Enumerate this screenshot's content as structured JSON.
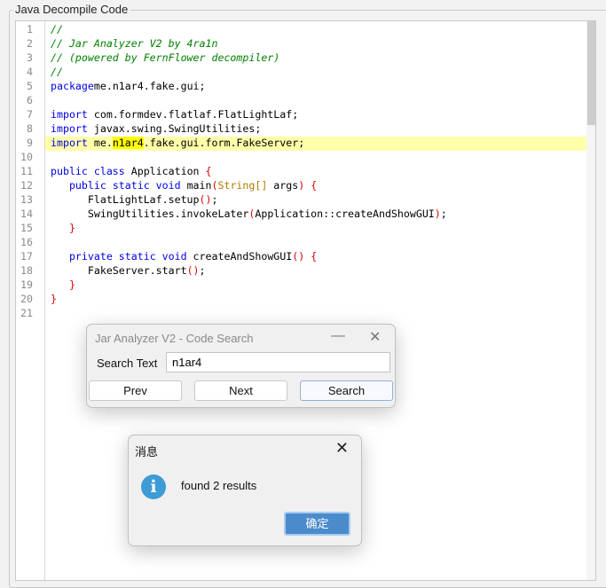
{
  "panel": {
    "title": "Java Decompile Code"
  },
  "editor": {
    "highlight_line": 9,
    "lines": [
      [
        [
          "cm",
          "//"
        ]
      ],
      [
        [
          "cm",
          "// Jar Analyzer V2 by 4ra1n"
        ]
      ],
      [
        [
          "cm",
          "// (powered by FernFlower decompiler)"
        ]
      ],
      [
        [
          "cm",
          "//"
        ]
      ],
      [
        [
          "kw",
          "package"
        ],
        [
          "",
          "me.n1ar4.fake.gui;"
        ]
      ],
      [],
      [
        [
          "kw",
          "import"
        ],
        [
          "",
          " com.formdev.flatlaf.FlatLightLaf;"
        ]
      ],
      [
        [
          "kw",
          "import"
        ],
        [
          "",
          " javax.swing.SwingUtilities;"
        ]
      ],
      [
        [
          "kw",
          "import"
        ],
        [
          "",
          " me."
        ],
        [
          "mk",
          "n1ar4"
        ],
        [
          "",
          ".fake.gui.form.FakeServer;"
        ]
      ],
      [],
      [
        [
          "kw",
          "public class"
        ],
        [
          "",
          " Application "
        ],
        [
          "br",
          "{"
        ]
      ],
      [
        [
          "",
          "   "
        ],
        [
          "kw",
          "public static void"
        ],
        [
          "",
          " main"
        ],
        [
          "br",
          "("
        ],
        [
          "ty",
          "String[]"
        ],
        [
          "",
          " args"
        ],
        [
          "br",
          ")"
        ],
        [
          "",
          " "
        ],
        [
          "br",
          "{"
        ]
      ],
      [
        [
          "",
          "      FlatLightLaf.setup"
        ],
        [
          "br",
          "()"
        ],
        [
          "",
          ";"
        ]
      ],
      [
        [
          "",
          "      SwingUtilities.invokeLater"
        ],
        [
          "br",
          "("
        ],
        [
          "",
          "Application::createAndShowGUI"
        ],
        [
          "br",
          ")"
        ],
        [
          "",
          ";"
        ]
      ],
      [
        [
          "",
          "   "
        ],
        [
          "br",
          "}"
        ]
      ],
      [],
      [
        [
          "",
          "   "
        ],
        [
          "kw",
          "private static void"
        ],
        [
          "",
          " createAndShowGUI"
        ],
        [
          "br",
          "()"
        ],
        [
          "",
          " "
        ],
        [
          "br",
          "{"
        ]
      ],
      [
        [
          "",
          "      FakeServer.start"
        ],
        [
          "br",
          "()"
        ],
        [
          "",
          ";"
        ]
      ],
      [
        [
          "",
          "   "
        ],
        [
          "br",
          "}"
        ]
      ],
      [
        [
          "br",
          "}"
        ]
      ],
      []
    ]
  },
  "search_dialog": {
    "title": "Jar Analyzer V2 - Code Search",
    "minimize": "—",
    "close": "✕",
    "label": "Search Text",
    "value": "n1ar4",
    "prev": "Prev",
    "next": "Next",
    "search": "Search"
  },
  "message_dialog": {
    "title": "消息",
    "close": "✕",
    "icon": "info-icon",
    "icon_glyph": "i",
    "text": "found 2 results",
    "ok": "确定"
  }
}
